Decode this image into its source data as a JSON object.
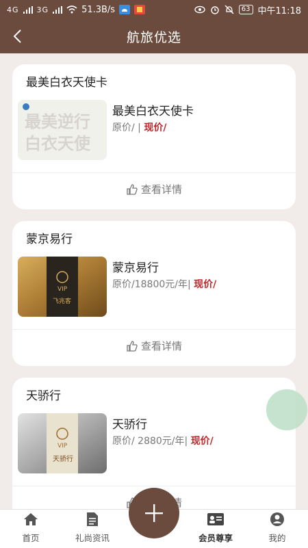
{
  "status": {
    "signal1": "4G",
    "signal2": "3G",
    "speed": "51.3B/s",
    "time": "中午11:18",
    "battery": "63"
  },
  "header": {
    "title": "航旅优选"
  },
  "cards": [
    {
      "section": "最美白衣天使卡",
      "name": "最美白衣天使卡",
      "price": "原价/ |",
      "now": "现价/",
      "details": "查看详情"
    },
    {
      "section": "蒙京易行",
      "name": "蒙京易行",
      "price": "原价/18800元/年|",
      "now": "现价/",
      "details": "查看详情"
    },
    {
      "section": "天骄行",
      "name": "天骄行",
      "price": "原价/ 2880元/年|",
      "now": "现价/",
      "details": "查看详情"
    }
  ],
  "tabs": [
    {
      "label": "首页",
      "icon": "home-icon"
    },
    {
      "label": "礼尚资讯",
      "icon": "document-icon"
    },
    {
      "label": "",
      "icon": "plus-icon"
    },
    {
      "label": "会员尊享",
      "icon": "member-card-icon"
    },
    {
      "label": "我的",
      "icon": "person-icon"
    }
  ],
  "thumb_text": {
    "card1_a": "最美逆行",
    "card1_b": "白衣天使",
    "card2_vip": "VIP",
    "card2_brand": "飞兆客",
    "card3_vip": "VIP",
    "card3_brand": "天骄行"
  },
  "colors": {
    "brand": "#6a4b3e",
    "accent_price": "#c0282c",
    "background": "#f1ecea"
  }
}
